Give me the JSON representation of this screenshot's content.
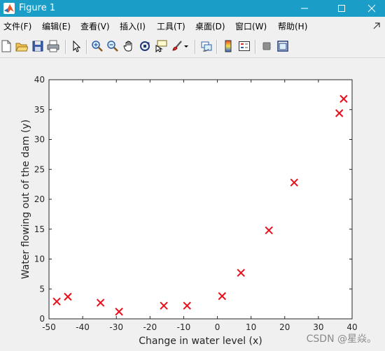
{
  "window": {
    "title": "Figure 1",
    "title_bar_color": "#1a9dc7"
  },
  "menu": {
    "items": [
      {
        "label": "文件(F)"
      },
      {
        "label": "编辑(E)"
      },
      {
        "label": "查看(V)"
      },
      {
        "label": "插入(I)"
      },
      {
        "label": "工具(T)"
      },
      {
        "label": "桌面(D)"
      },
      {
        "label": "窗口(W)"
      },
      {
        "label": "帮助(H)"
      }
    ]
  },
  "toolbar": {
    "icons": [
      "new-figure-icon",
      "open-file-icon",
      "save-icon",
      "print-icon",
      "pointer-icon",
      "zoom-in-icon",
      "zoom-out-icon",
      "pan-hand-icon",
      "rotate-3d-icon",
      "data-cursor-icon",
      "brush-icon",
      "link-plot-icon",
      "colorbar-icon",
      "legend-icon",
      "hide-plot-tools-icon",
      "show-plot-tools-icon"
    ]
  },
  "chart_data": {
    "type": "scatter",
    "title": "",
    "xlabel": "Change in water level (x)",
    "ylabel": "Water flowing out of the dam (y)",
    "xlim": [
      -50,
      40
    ],
    "ylim": [
      0,
      40
    ],
    "xticks": [
      "-50",
      "-40",
      "-30",
      "-20",
      "-10",
      "0",
      "10",
      "20",
      "30",
      "40"
    ],
    "yticks": [
      "0",
      "5",
      "10",
      "15",
      "20",
      "25",
      "30",
      "35",
      "40"
    ],
    "marker": "x",
    "marker_color": "#e8101c",
    "grid": false,
    "points": [
      {
        "x": -47.7,
        "y": 2.9
      },
      {
        "x": -44.4,
        "y": 3.7
      },
      {
        "x": -34.7,
        "y": 2.7
      },
      {
        "x": -29.2,
        "y": 1.2
      },
      {
        "x": -15.9,
        "y": 2.2
      },
      {
        "x": -9.0,
        "y": 2.2
      },
      {
        "x": 1.4,
        "y": 3.8
      },
      {
        "x": 7.0,
        "y": 7.7
      },
      {
        "x": 15.3,
        "y": 14.8
      },
      {
        "x": 22.8,
        "y": 22.8
      },
      {
        "x": 36.2,
        "y": 34.4
      },
      {
        "x": 37.5,
        "y": 36.8
      }
    ]
  },
  "watermark": "CSDN @星焱。"
}
